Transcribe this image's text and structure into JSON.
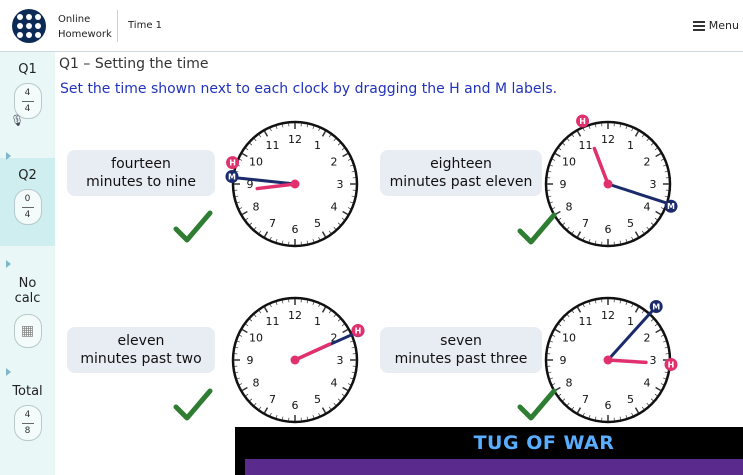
{
  "header": {
    "app_line1": "Online",
    "app_line2": "Homework",
    "task_title": "Time 1",
    "menu_label": "Menu"
  },
  "sidebar": {
    "q1": {
      "label": "Q1",
      "score": "4",
      "total": "4"
    },
    "q2": {
      "label": "Q2",
      "score": "0",
      "total": "4"
    },
    "calc": {
      "label_line1": "No",
      "label_line2": "calc"
    },
    "totals": {
      "label": "Total",
      "score": "4",
      "total": "8"
    }
  },
  "main": {
    "question_title": "Q1 – Setting the time",
    "instruction": "Set the time shown next to each clock by dragging the H and M labels.",
    "clocks": [
      {
        "line1": "fourteen",
        "line2": "minutes to nine",
        "result": "correct"
      },
      {
        "line1": "eighteen",
        "line2": "minutes past eleven",
        "result": "correct"
      },
      {
        "line1": "eleven",
        "line2": "minutes past two",
        "result": "correct"
      },
      {
        "line1": "seven",
        "line2": "minutes past three",
        "result": "correct"
      }
    ],
    "hand_labels": {
      "hour": "H",
      "minute": "M"
    },
    "numerals": [
      "12",
      "1",
      "2",
      "3",
      "4",
      "5",
      "6",
      "7",
      "8",
      "9",
      "10",
      "11"
    ]
  },
  "banner": {
    "title": "TUG OF WAR"
  },
  "colors": {
    "hour_hand": "#e0306e",
    "minute_hand": "#1b2a6b",
    "tick_green": "#2e7d32",
    "instruction_blue": "#2233bb",
    "banner_purple": "#5a2b8c"
  }
}
